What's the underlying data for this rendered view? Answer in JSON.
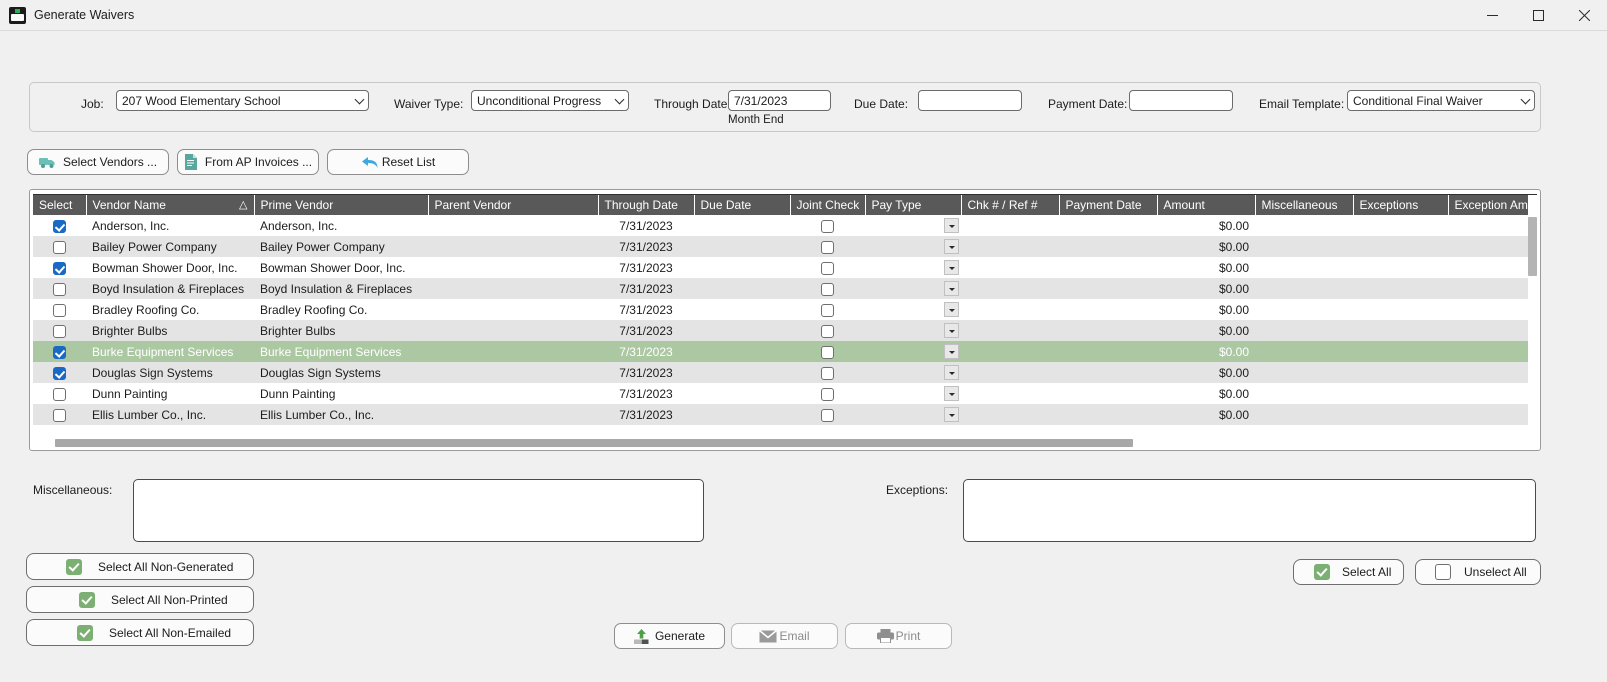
{
  "window": {
    "title": "Generate Waivers",
    "icon": "app-icon",
    "minimize_label": "Minimize",
    "maximize_label": "Maximize",
    "close_label": "Close"
  },
  "filters": {
    "job_label": "Job:",
    "job_value": "207  Wood Elementary School",
    "waiver_type_label": "Waiver Type:",
    "waiver_type_value": "Unconditional Progress",
    "through_date_label": "Through Date:",
    "through_date_value": "7/31/2023",
    "through_date_note": "Month End",
    "due_date_label": "Due Date:",
    "due_date_value": "",
    "payment_date_label": "Payment Date:",
    "payment_date_value": "",
    "email_template_label": "Email Template:",
    "email_template_value": "Conditional Final Waiver"
  },
  "toolbar": {
    "select_vendors": "Select Vendors ...",
    "from_ap_invoices": "From AP Invoices ...",
    "reset_list": "Reset List"
  },
  "grid": {
    "columns": [
      "Select",
      "Vendor Name",
      "Prime Vendor",
      "Parent Vendor",
      "Through Date",
      "Due Date",
      "Joint Check",
      "Pay Type",
      "Chk # / Ref #",
      "Payment Date",
      "Amount",
      "Miscellaneous",
      "Exceptions",
      "Exception Am"
    ],
    "sort_column": "Vendor Name",
    "sort_indicator": "△",
    "rows": [
      {
        "select": true,
        "vendor": "Anderson, Inc.",
        "prime": "Anderson, Inc.",
        "parent": "",
        "through": "7/31/2023",
        "due": "",
        "joint": false,
        "paytype": "",
        "chk": "",
        "paydate": "",
        "amount": "$0.00",
        "misc": "",
        "exceptions": "",
        "exception_amt": "",
        "selected": false
      },
      {
        "select": false,
        "vendor": "Bailey Power Company",
        "prime": "Bailey Power Company",
        "parent": "",
        "through": "7/31/2023",
        "due": "",
        "joint": false,
        "paytype": "",
        "chk": "",
        "paydate": "",
        "amount": "$0.00",
        "misc": "",
        "exceptions": "",
        "exception_amt": "",
        "selected": false
      },
      {
        "select": true,
        "vendor": "Bowman Shower Door, Inc.",
        "prime": "Bowman Shower Door, Inc.",
        "parent": "",
        "through": "7/31/2023",
        "due": "",
        "joint": false,
        "paytype": "",
        "chk": "",
        "paydate": "",
        "amount": "$0.00",
        "misc": "",
        "exceptions": "",
        "exception_amt": "",
        "selected": false
      },
      {
        "select": false,
        "vendor": "Boyd Insulation & Fireplaces",
        "prime": "Boyd Insulation & Fireplaces",
        "parent": "",
        "through": "7/31/2023",
        "due": "",
        "joint": false,
        "paytype": "",
        "chk": "",
        "paydate": "",
        "amount": "$0.00",
        "misc": "",
        "exceptions": "",
        "exception_amt": "",
        "selected": false
      },
      {
        "select": false,
        "vendor": "Bradley Roofing Co.",
        "prime": "Bradley Roofing Co.",
        "parent": "",
        "through": "7/31/2023",
        "due": "",
        "joint": false,
        "paytype": "",
        "chk": "",
        "paydate": "",
        "amount": "$0.00",
        "misc": "",
        "exceptions": "",
        "exception_amt": "",
        "selected": false
      },
      {
        "select": false,
        "vendor": "Brighter Bulbs",
        "prime": "Brighter Bulbs",
        "parent": "",
        "through": "7/31/2023",
        "due": "",
        "joint": false,
        "paytype": "",
        "chk": "",
        "paydate": "",
        "amount": "$0.00",
        "misc": "",
        "exceptions": "",
        "exception_amt": "",
        "selected": false
      },
      {
        "select": true,
        "vendor": "Burke Equipment Services",
        "prime": "Burke Equipment Services",
        "parent": "",
        "through": "7/31/2023",
        "due": "",
        "joint": false,
        "paytype": "",
        "chk": "",
        "paydate": "",
        "amount": "$0.00",
        "misc": "",
        "exceptions": "",
        "exception_amt": "",
        "selected": true
      },
      {
        "select": true,
        "vendor": "Douglas Sign Systems",
        "prime": "Douglas Sign Systems",
        "parent": "",
        "through": "7/31/2023",
        "due": "",
        "joint": false,
        "paytype": "",
        "chk": "",
        "paydate": "",
        "amount": "$0.00",
        "misc": "",
        "exceptions": "",
        "exception_amt": "",
        "selected": false
      },
      {
        "select": false,
        "vendor": "Dunn Painting",
        "prime": "Dunn Painting",
        "parent": "",
        "through": "7/31/2023",
        "due": "",
        "joint": false,
        "paytype": "",
        "chk": "",
        "paydate": "",
        "amount": "$0.00",
        "misc": "",
        "exceptions": "",
        "exception_amt": "",
        "selected": false
      },
      {
        "select": false,
        "vendor": "Ellis Lumber Co., Inc.",
        "prime": "Ellis Lumber Co., Inc.",
        "parent": "",
        "through": "7/31/2023",
        "due": "",
        "joint": false,
        "paytype": "",
        "chk": "",
        "paydate": "",
        "amount": "$0.00",
        "misc": "",
        "exceptions": "",
        "exception_amt": "",
        "selected": false
      }
    ]
  },
  "memos": {
    "misc_label": "Miscellaneous:",
    "misc_value": "",
    "exceptions_label": "Exceptions:",
    "exceptions_value": ""
  },
  "bulk": {
    "select_all_non_generated": "Select All Non-Generated",
    "select_all_non_printed": "Select All Non-Printed",
    "select_all_non_emailed": "Select All Non-Emailed",
    "select_all": "Select All",
    "unselect_all": "Unselect All"
  },
  "actions": {
    "generate": "Generate",
    "email": "Email",
    "print": "Print"
  },
  "colors": {
    "selected_row": "#acc8a3",
    "header": "#595959",
    "checkbox_checked": "#1a69c4",
    "green_check": "#7cb073",
    "window_bg": "#f0f0f0"
  }
}
